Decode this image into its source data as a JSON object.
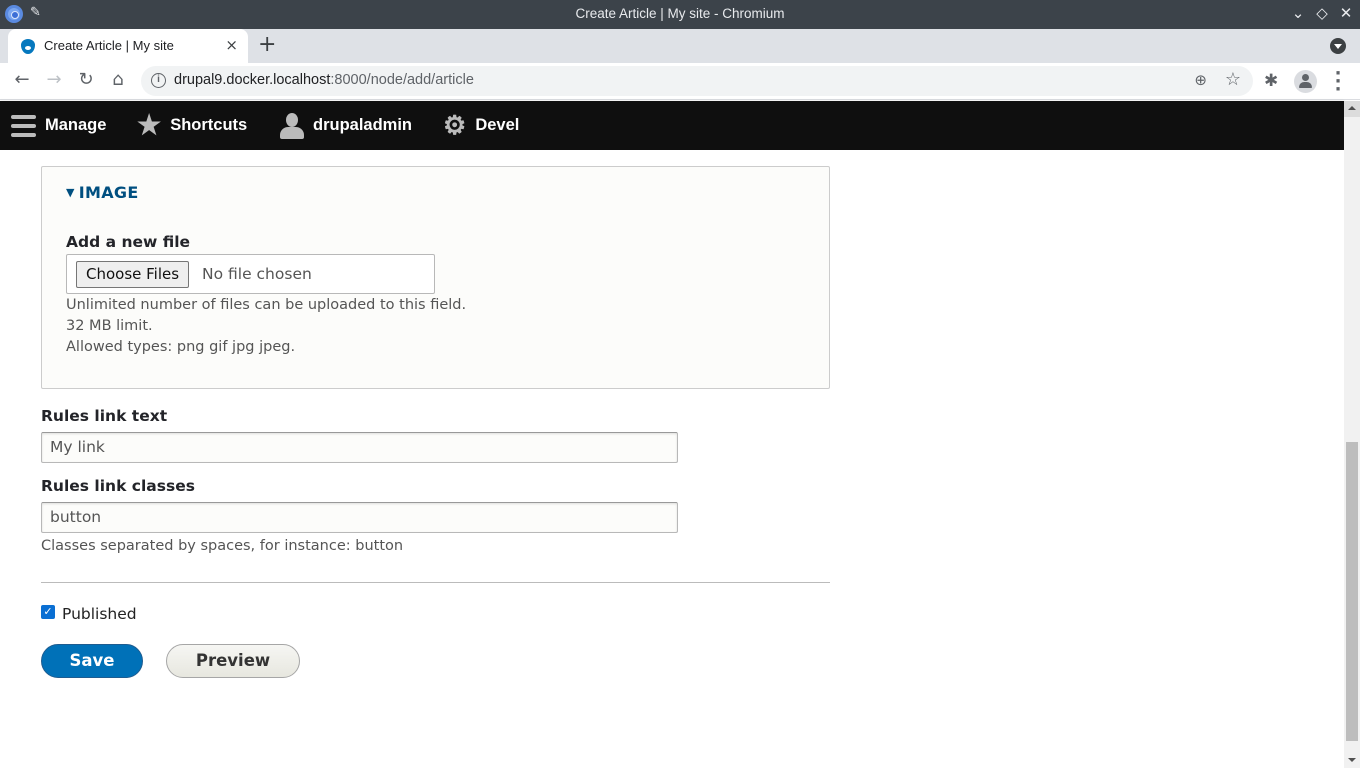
{
  "window": {
    "title": "Create Article | My site - Chromium",
    "pin_icon": "pin-icon",
    "controls": [
      "minimize",
      "maximize",
      "close"
    ]
  },
  "tab": {
    "title": "Create Article | My site",
    "close": "×",
    "new_tab": "+"
  },
  "toolbar": {
    "url_host": "drupal9.docker.localhost",
    "url_rest": ":8000/node/add/article"
  },
  "drupal_toolbar": {
    "items": [
      {
        "label": "Manage",
        "icon": "hamburger-icon"
      },
      {
        "label": "Shortcuts",
        "icon": "star-icon"
      },
      {
        "label": "drupaladmin",
        "icon": "user-icon"
      },
      {
        "label": "Devel",
        "icon": "gear-icon"
      }
    ]
  },
  "image_fieldset": {
    "summary": "IMAGE",
    "add_file_label": "Add a new file",
    "choose_button": "Choose Files",
    "no_file": "No file chosen",
    "descriptions": [
      "Unlimited number of files can be uploaded to this field.",
      "32 MB limit.",
      "Allowed types: png gif jpg jpeg."
    ]
  },
  "rules_link_text": {
    "label": "Rules link text",
    "value": "My link"
  },
  "rules_link_classes": {
    "label": "Rules link classes",
    "value": "button",
    "description": "Classes separated by spaces, for instance: button"
  },
  "published": {
    "label": "Published",
    "checked": true
  },
  "actions": {
    "save": "Save",
    "preview": "Preview"
  },
  "colors": {
    "primary": "#0071b8",
    "summary_link": "#004f80",
    "drupal_bar": "#0f0f0f"
  }
}
